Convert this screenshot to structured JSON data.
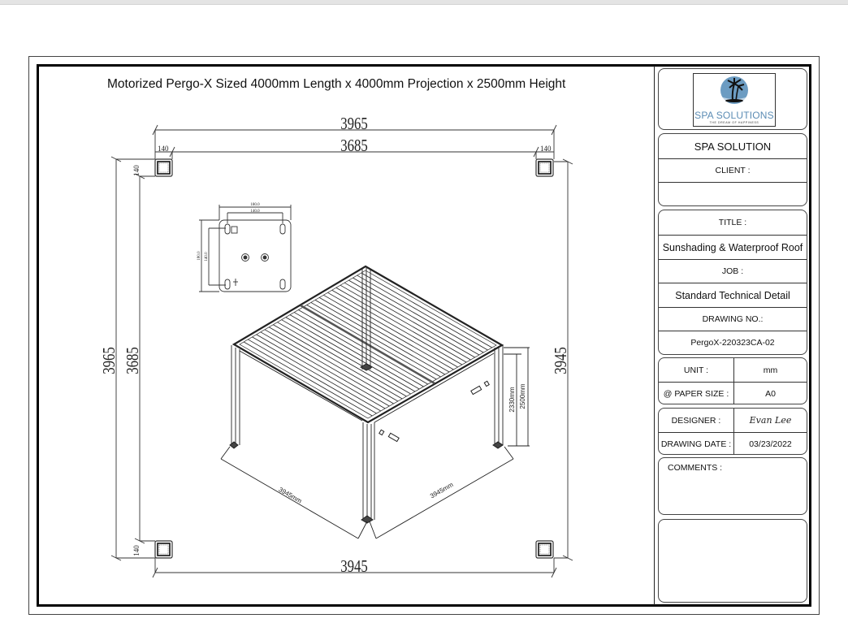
{
  "drawing": {
    "title": "Motorized Pergo-X Sized 4000mm Length x 4000mm Projection x 2500mm Height",
    "plan_dimensions": {
      "top_overall": "3965",
      "top_inner": "3685",
      "top_left_post": "140",
      "top_right_post": "140",
      "left_overall": "3965",
      "left_inner": "3685",
      "left_top_post": "140",
      "left_bottom_post": "140",
      "right_overall": "3945",
      "bottom_overall": "3945"
    },
    "base_plate_dimensions": {
      "width_outer": "180.0",
      "width_holes": "140.0",
      "height_outer": "180.0",
      "height_holes": "140.0"
    },
    "iso_dimensions": {
      "length_left": "3945mm",
      "length_right": "3945mm",
      "clear_height": "2330mm",
      "total_height": "2500mm"
    }
  },
  "title_block": {
    "logo": {
      "name": "SPA SOLUTIONS",
      "tagline": "THE DREAM OF HAPPINESS",
      "accent_color": "#5b8cb4"
    },
    "company": "SPA SOLUTION",
    "client_label": "CLIENT :",
    "client_value": "",
    "title_label": "TITLE :",
    "title_value": "Sunshading & Waterproof Roof",
    "job_label": "JOB :",
    "job_value": "Standard Technical Detail",
    "drawing_no_label": "DRAWING NO.:",
    "drawing_no_value": "PergoX-220323CA-02",
    "unit_label": "UNIT :",
    "unit_value": "mm",
    "paper_size_label": "@ PAPER SIZE :",
    "paper_size_value": "A0",
    "designer_label": "DESIGNER :",
    "designer_value": "Evan Lee",
    "drawing_date_label": "DRAWING DATE :",
    "drawing_date_value": "03/23/2022",
    "comments_label": "COMMENTS :",
    "comments_value": ""
  }
}
